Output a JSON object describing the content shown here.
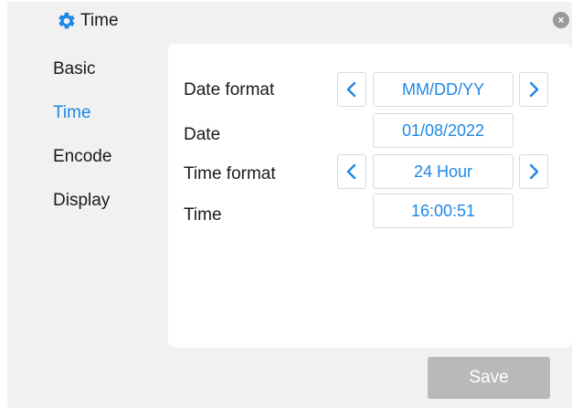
{
  "header": {
    "title": "Time",
    "icon": "gear-icon",
    "accent": "#1e88e5"
  },
  "close": {
    "icon": "close-icon",
    "glyph": "×"
  },
  "sidebar": {
    "items": [
      {
        "label": "Basic",
        "active": false
      },
      {
        "label": "Time",
        "active": true
      },
      {
        "label": "Encode",
        "active": false
      },
      {
        "label": "Display",
        "active": false
      }
    ]
  },
  "form": {
    "date_format": {
      "label": "Date format",
      "value": "MM/DD/YY"
    },
    "date": {
      "label": "Date",
      "value": "01/08/2022"
    },
    "time_format": {
      "label": "Time format",
      "value": "24 Hour"
    },
    "time": {
      "label": "Time",
      "value": "16:00:51"
    }
  },
  "footer": {
    "save_label": "Save"
  },
  "colors": {
    "accent": "#1e88e5",
    "panel_bg": "#f1f1f1",
    "save_bg": "#b9b9b9"
  }
}
